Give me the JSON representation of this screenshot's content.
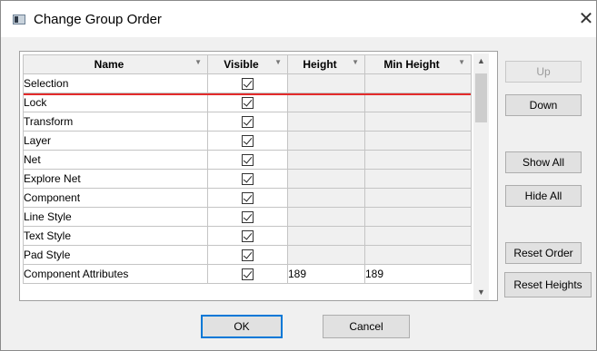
{
  "window": {
    "title": "Change Group Order",
    "close_glyph": "✕"
  },
  "grid": {
    "columns": [
      "Name",
      "Visible",
      "Height",
      "Min Height"
    ],
    "rows": [
      {
        "name": "Selection",
        "visible": true,
        "height": "",
        "min_height": ""
      },
      {
        "name": "Lock",
        "visible": true,
        "height": "",
        "min_height": ""
      },
      {
        "name": "Transform",
        "visible": true,
        "height": "",
        "min_height": ""
      },
      {
        "name": "Layer",
        "visible": true,
        "height": "",
        "min_height": ""
      },
      {
        "name": "Net",
        "visible": true,
        "height": "",
        "min_height": ""
      },
      {
        "name": "Explore Net",
        "visible": true,
        "height": "",
        "min_height": ""
      },
      {
        "name": "Component",
        "visible": true,
        "height": "",
        "min_height": ""
      },
      {
        "name": "Line Style",
        "visible": true,
        "height": "",
        "min_height": ""
      },
      {
        "name": "Text Style",
        "visible": true,
        "height": "",
        "min_height": ""
      },
      {
        "name": "Pad Style",
        "visible": true,
        "height": "",
        "min_height": ""
      },
      {
        "name": "Component Attributes",
        "visible": true,
        "height": "189",
        "min_height": "189"
      }
    ],
    "drop_indicator_color": "#e32b2b"
  },
  "buttons": {
    "up": "Up",
    "down": "Down",
    "show_all": "Show All",
    "hide_all": "Hide All",
    "reset_order": "Reset Order",
    "reset_heights": "Reset Heights",
    "ok": "OK",
    "cancel": "Cancel"
  },
  "icons": {
    "app": "window-icon",
    "sort": "filter-dropdown-icon",
    "scroll_up": "scroll-up-icon",
    "scroll_down": "scroll-down-icon"
  }
}
